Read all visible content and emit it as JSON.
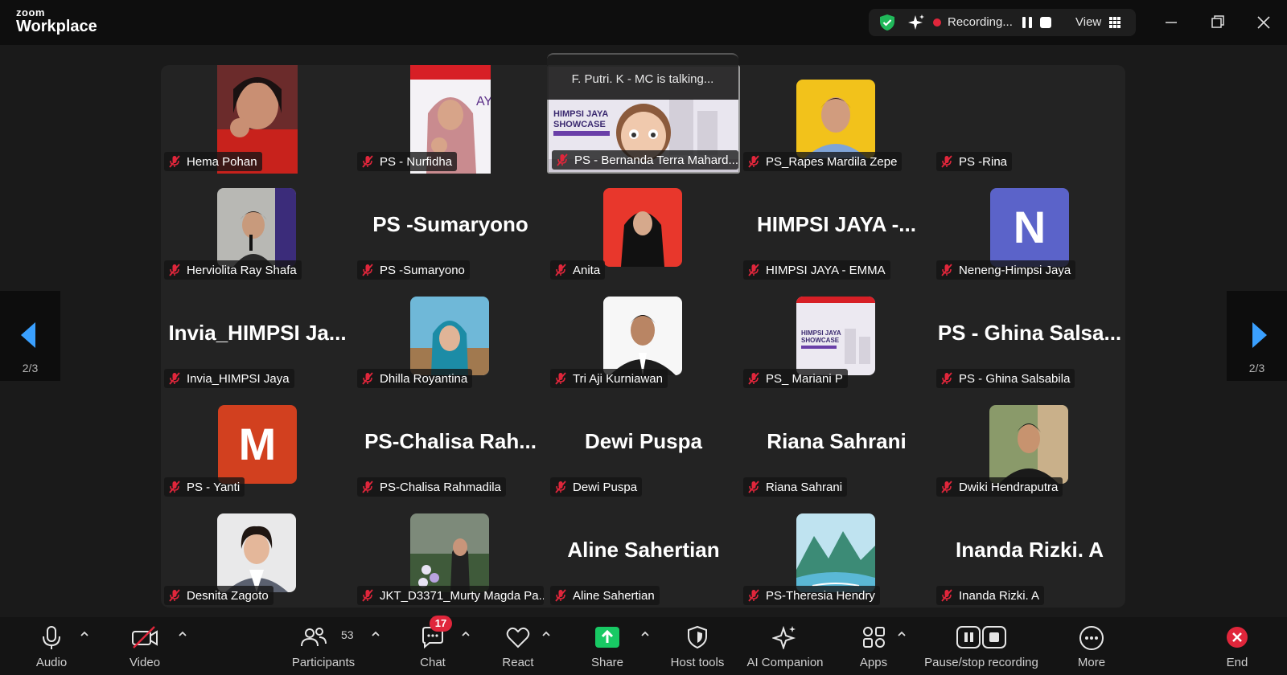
{
  "app": {
    "brand_top": "zoom",
    "brand_bottom": "Workplace"
  },
  "status": {
    "recording_label": "Recording...",
    "view_label": "View"
  },
  "talking": "F. Putri. K - MC is talking...",
  "pager": {
    "left_page": "2/3",
    "right_page": "2/3"
  },
  "colors": {
    "accent_blue": "#3aa0ff",
    "red": "#e0263b",
    "share_green": "#18c964",
    "tile_bg": "#232323"
  },
  "tiles": [
    {
      "name": "Hema Pohan",
      "kind": "photo"
    },
    {
      "name": "PS - Nurfidha",
      "kind": "photo"
    },
    {
      "name": "PS - Bernanda Terra Mahard...",
      "kind": "video"
    },
    {
      "name": "PS_Rapes Mardila Zepe",
      "kind": "photo"
    },
    {
      "name": "PS -Rina",
      "kind": "blank"
    },
    {
      "name": "Herviolita Ray Shafa",
      "kind": "photo"
    },
    {
      "name": "PS -Sumaryono",
      "kind": "text",
      "big": "PS -Sumaryono"
    },
    {
      "name": "Anita",
      "kind": "photo"
    },
    {
      "name": "HIMPSI JAYA - EMMA",
      "kind": "text",
      "big": "HIMPSI JAYA -..."
    },
    {
      "name": "Neneng-Himpsi Jaya",
      "kind": "letter",
      "letter": "N"
    },
    {
      "name": "Invia_HIMPSI Jaya",
      "kind": "text",
      "big": "Invia_HIMPSI Ja..."
    },
    {
      "name": "Dhilla Royantina",
      "kind": "photo"
    },
    {
      "name": "Tri Aji Kurniawan",
      "kind": "photo"
    },
    {
      "name": "PS_ Mariani P",
      "kind": "photo"
    },
    {
      "name": "PS - Ghina Salsabila",
      "kind": "text",
      "big": "PS - Ghina Salsa..."
    },
    {
      "name": "PS - Yanti",
      "kind": "letter",
      "letter": "M"
    },
    {
      "name": "PS-Chalisa Rahmadila",
      "kind": "text",
      "big": "PS-Chalisa Rah..."
    },
    {
      "name": "Dewi Puspa",
      "kind": "text",
      "big": "Dewi Puspa"
    },
    {
      "name": "Riana Sahrani",
      "kind": "text",
      "big": "Riana Sahrani"
    },
    {
      "name": "Dwiki Hendraputra",
      "kind": "photo"
    },
    {
      "name": "Desnita Zagoto",
      "kind": "photo"
    },
    {
      "name": "JKT_D3371_Murty Magda Pa...",
      "kind": "photo"
    },
    {
      "name": "Aline Sahertian",
      "kind": "text",
      "big": "Aline Sahertian"
    },
    {
      "name": "PS-Theresia Hendry",
      "kind": "photo"
    },
    {
      "name": "Inanda Rizki. A",
      "kind": "text",
      "big": "Inanda Rizki. A"
    }
  ],
  "slide": {
    "title_line1": "HIMPSI JAYA",
    "title_line2": "SHOWCASE"
  },
  "toolbar": {
    "audio": "Audio",
    "video": "Video",
    "participants": "Participants",
    "participants_count": "53",
    "chat": "Chat",
    "chat_badge": "17",
    "react": "React",
    "share": "Share",
    "host_tools": "Host tools",
    "ai_companion": "AI Companion",
    "apps": "Apps",
    "pause_stop": "Pause/stop recording",
    "more": "More",
    "end": "End"
  }
}
